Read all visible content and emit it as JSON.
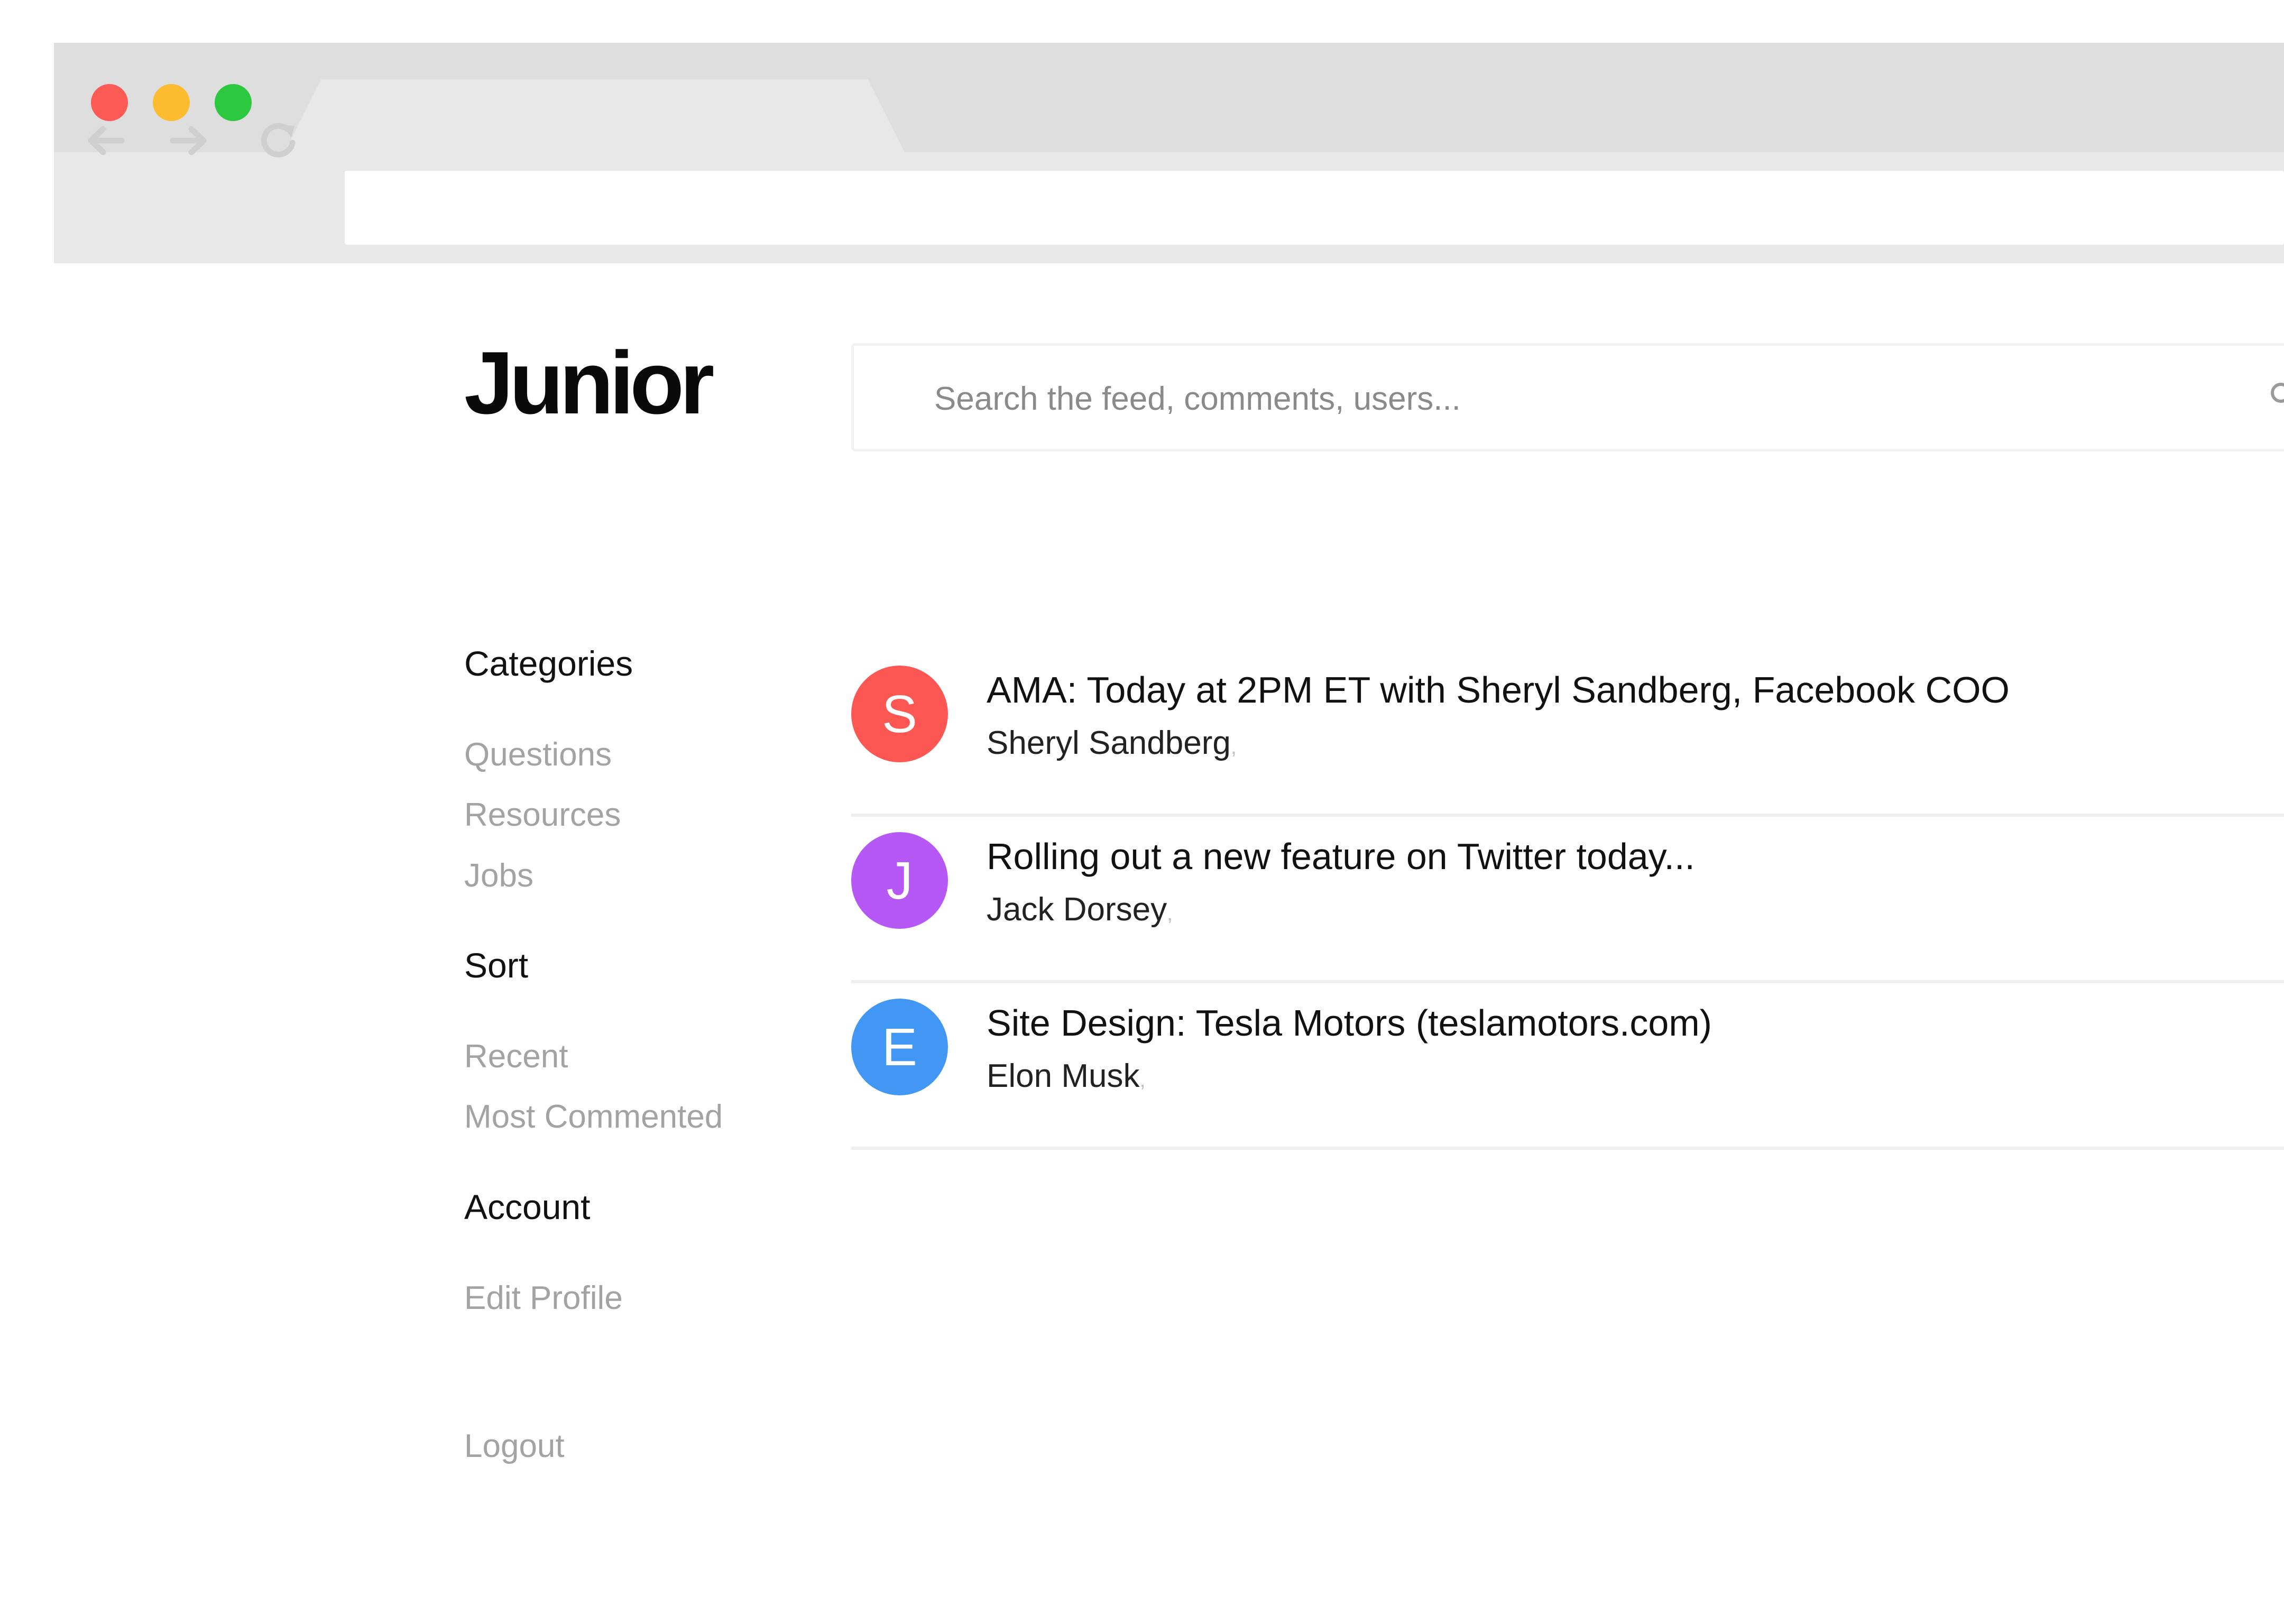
{
  "browser": {
    "window_controls": [
      "close",
      "minimize",
      "maximize"
    ],
    "nav_icons": [
      "back-arrow-icon",
      "forward-arrow-icon",
      "reload-icon"
    ],
    "address_value": ""
  },
  "brand": {
    "logo": "Junior"
  },
  "search": {
    "placeholder": "Search the feed, comments, users...",
    "icon": "search-icon"
  },
  "sidebar": {
    "categories_heading": "Categories",
    "categories": [
      "Questions",
      "Resources",
      "Jobs"
    ],
    "sort_heading": "Sort",
    "sort_options": [
      "Recent",
      "Most Commented"
    ],
    "account_heading": "Account",
    "account_links": [
      "Edit Profile"
    ],
    "logout": "Logout"
  },
  "feed": [
    {
      "initial": "S",
      "title": "AMA: Today at 2PM ET with Sheryl Sandberg, Facebook COO",
      "author": "Sheryl Sandberg",
      "separator": ",",
      "color": "#fd5753"
    },
    {
      "initial": "J",
      "title": "Rolling out a new feature on Twitter today...",
      "author": "Jack Dorsey",
      "separator": ",",
      "color": "#b558f6"
    },
    {
      "initial": "E",
      "title": "Site Design: Tesla Motors (teslamotors.com)",
      "author": "Elon Musk",
      "separator": ",",
      "color": "#4197f3"
    }
  ]
}
